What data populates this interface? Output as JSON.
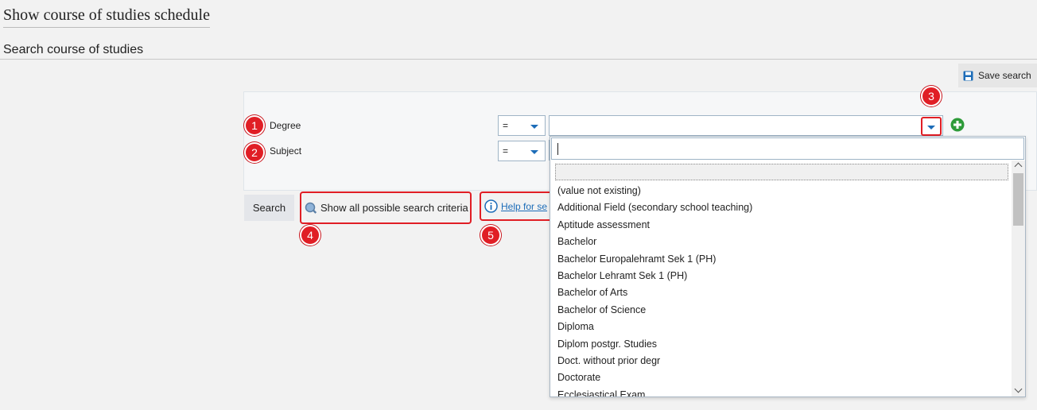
{
  "page": {
    "title": "Show course of studies schedule",
    "section_title": "Search course of studies"
  },
  "toolbar": {
    "save_search_label": "Save search"
  },
  "criteria": [
    {
      "badge": "1",
      "label": "Degree",
      "operator": "="
    },
    {
      "badge": "2",
      "label": "Subject",
      "operator": "="
    }
  ],
  "annotations": {
    "dropdown_button_badge": "3",
    "show_all_badge": "4",
    "help_badge": "5"
  },
  "actions": {
    "search_label": "Search",
    "show_all_label": "Show all possible search criteria",
    "help_label": "Help for se"
  },
  "dropdown": {
    "search_value": "",
    "options": [
      "(value not existing)",
      "Additional Field (secondary school teaching)",
      "Aptitude assessment",
      "Bachelor",
      "Bachelor Europalehramt Sek 1 (PH)",
      "Bachelor Lehramt Sek 1 (PH)",
      "Bachelor of Arts",
      "Bachelor of Science",
      "Diploma",
      "Diplom postgr. Studies",
      "Doct. without prior degr",
      "Doctorate",
      "Ecclesiastical Exam"
    ]
  },
  "colors": {
    "accent": "#1c6cb8",
    "annotation_red": "#e01e25",
    "add_green": "#2e9b3a"
  }
}
